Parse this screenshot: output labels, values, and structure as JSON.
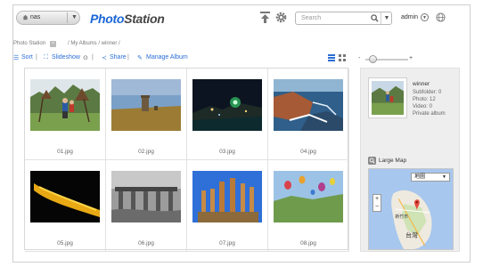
{
  "header": {
    "nas_label": "nas",
    "logo_part1": "Photo",
    "logo_part2": "Station",
    "search_placeholder": "Search",
    "user": "admin"
  },
  "breadcrumb": {
    "root": "Photo Station",
    "path": "/ My Albums / winner /"
  },
  "toolbar": {
    "sort": "Sort",
    "slideshow": "Slideshow",
    "share": "Share",
    "manage_album": "Manage Album",
    "separator": "|"
  },
  "photos": [
    {
      "name": "01.jpg"
    },
    {
      "name": "02.jpg"
    },
    {
      "name": "03.jpg"
    },
    {
      "name": "04.jpg"
    },
    {
      "name": "05.jpg"
    },
    {
      "name": "06.jpg"
    },
    {
      "name": "07.jpg"
    },
    {
      "name": "08.jpg"
    }
  ],
  "album": {
    "name": "winner",
    "subfolder": "Subfolder: 0",
    "photo": "Photo: 12",
    "video": "Video: 0",
    "privacy": "Private album"
  },
  "map": {
    "label": "Large Map",
    "map_type": "地圖",
    "city_label": "新竹市",
    "region_label": "台灣",
    "zoom_in": "+",
    "zoom_out": "−"
  },
  "colors": {
    "brand_blue": "#1a66d6",
    "link_blue": "#2a6ed4",
    "panel_bg": "#eeeeee"
  }
}
